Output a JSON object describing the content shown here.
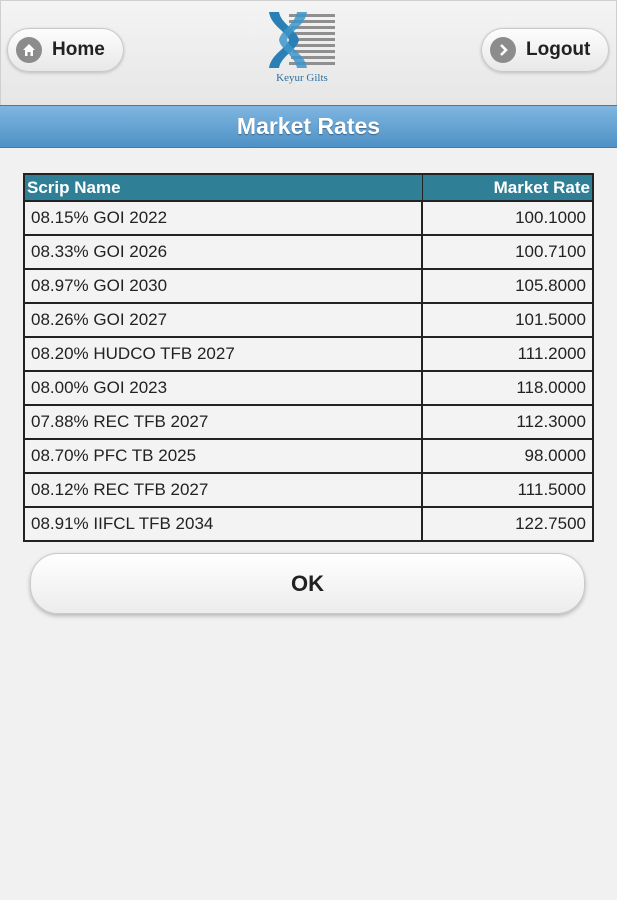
{
  "header": {
    "home_label": "Home",
    "logout_label": "Logout",
    "logo_text": "Keyur Gilts",
    "home_icon": "home-icon",
    "logout_icon": "arrow-right-icon"
  },
  "title": "Market Rates",
  "table": {
    "columns": [
      "Scrip Name",
      "Market Rate"
    ],
    "rows": [
      {
        "name": "08.15% GOI 2022",
        "rate": "100.1000"
      },
      {
        "name": "08.33% GOI 2026",
        "rate": "100.7100"
      },
      {
        "name": "08.97% GOI 2030",
        "rate": "105.8000"
      },
      {
        "name": "08.26% GOI 2027",
        "rate": "101.5000"
      },
      {
        "name": "08.20% HUDCO TFB 2027",
        "rate": "111.2000"
      },
      {
        "name": "08.00% GOI 2023",
        "rate": "118.0000"
      },
      {
        "name": "07.88% REC TFB 2027",
        "rate": "112.3000"
      },
      {
        "name": "08.70% PFC TB 2025",
        "rate": "98.0000"
      },
      {
        "name": "08.12% REC TFB 2027",
        "rate": "111.5000"
      },
      {
        "name": "08.91% IIFCL TFB 2034",
        "rate": "122.7500"
      }
    ]
  },
  "ok_label": "OK",
  "colors": {
    "title_bar": "#4f91c6",
    "table_header": "#2f7f97",
    "logo": "#2a6f9e"
  }
}
